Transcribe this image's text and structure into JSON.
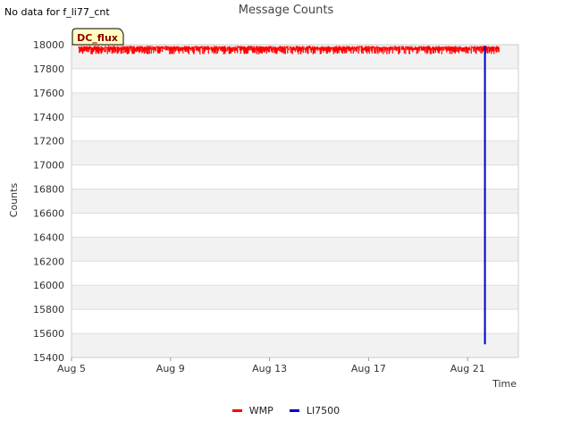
{
  "header": {
    "nodata_text": "No data for f_li77_cnt",
    "title": "Message Counts"
  },
  "tag": {
    "label": "DC_flux"
  },
  "legend": [
    {
      "label": "WMP",
      "color": "#ff0000"
    },
    {
      "label": "LI7500",
      "color": "#0000cc"
    }
  ],
  "chart_data": {
    "type": "line",
    "title": "Message Counts",
    "xlabel": "Time",
    "ylabel": "Counts",
    "ylim": [
      15400,
      18000
    ],
    "yticks": [
      15400,
      15600,
      15800,
      16000,
      16200,
      16400,
      16600,
      16800,
      17000,
      17200,
      17400,
      17600,
      17800,
      18000
    ],
    "xlim": [
      "Aug 5",
      "Aug 23"
    ],
    "xticks": [
      {
        "label": "Aug 5",
        "day": 5
      },
      {
        "label": "Aug 9",
        "day": 9
      },
      {
        "label": "Aug 13",
        "day": 13
      },
      {
        "label": "Aug 17",
        "day": 17
      },
      {
        "label": "Aug 21",
        "day": 21
      }
    ],
    "grid": true,
    "legend_position": "bottom",
    "series": [
      {
        "name": "WMP",
        "color": "#ff0000",
        "x_range": [
          5.3,
          22.3
        ],
        "y_band": [
          17920,
          17990
        ]
      },
      {
        "name": "LI7500",
        "color": "#0000cc",
        "points": [
          {
            "x": 21.7,
            "y": 17990
          },
          {
            "x": 21.7,
            "y": 15510
          }
        ]
      }
    ]
  }
}
